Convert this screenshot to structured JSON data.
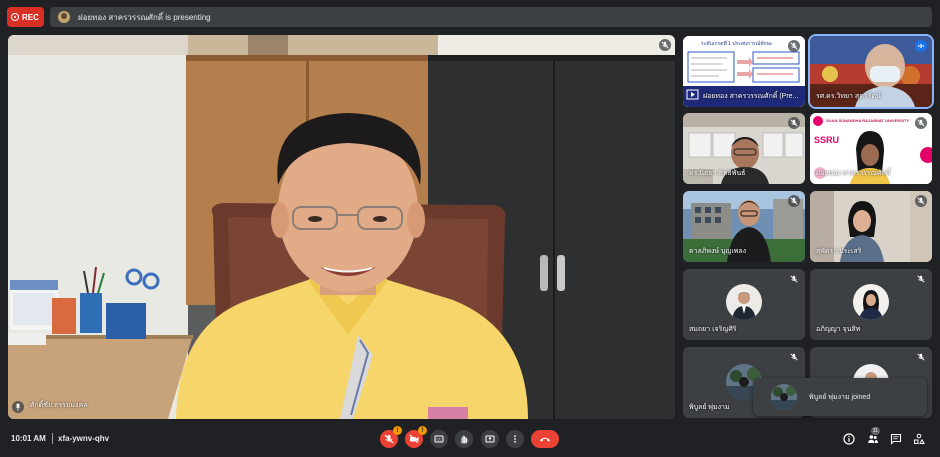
{
  "header": {
    "rec_label": "REC",
    "presenting_text": "ฝอยทอง สาครวรรณศักดิ์ is presenting"
  },
  "main_speaker": {
    "name": "ศักดิ์ชัย ธรรมมงคล"
  },
  "participants": [
    {
      "name": "ฝอยทอง สาครวรรณศักดิ์ (Pre...",
      "muted": true,
      "kind": "presentation",
      "slide_title": "ระดับเกรดที่ 1 ประสบการณ์ทักษะ"
    },
    {
      "name": "รศ.ดร.วิทยา สุดารัตน์",
      "muted": false,
      "kind": "video"
    },
    {
      "name": "ดร.นิตยา สิทธิพันธ์",
      "muted": true,
      "kind": "video"
    },
    {
      "name": "ฝอยทอง สาครวรรณศักดิ์",
      "muted": true,
      "kind": "video",
      "org_label": "SUAN SUNANDHA RAJABHAT UNIVERSITY",
      "org_short": "SSRU"
    },
    {
      "name": "ดาลภิพงษ์ บุญเพลง",
      "muted": true,
      "kind": "video"
    },
    {
      "name": "สุพัตรา ประเสริ",
      "muted": true,
      "kind": "video"
    },
    {
      "name": "สมถยา เจริญศิริ",
      "muted": true,
      "kind": "avatar"
    },
    {
      "name": "อภิญญา จุนสิท",
      "muted": true,
      "kind": "avatar"
    },
    {
      "name": "พิบูลย์ พุ่มงาม",
      "muted": true,
      "kind": "avatar"
    },
    {
      "name": "",
      "muted": true,
      "kind": "avatar"
    }
  ],
  "toast": {
    "text": "พิบูลย์ พุ่มงาม joined"
  },
  "footer": {
    "time": "10:01 AM",
    "meeting_code": "xfa-ywnv-qhv",
    "mic_badge": "!",
    "cam_badge": "!",
    "participant_count": "11"
  },
  "colors": {
    "background": "#202124",
    "tile": "#3c4043",
    "danger": "#ea4335",
    "warning_badge": "#f29900"
  }
}
